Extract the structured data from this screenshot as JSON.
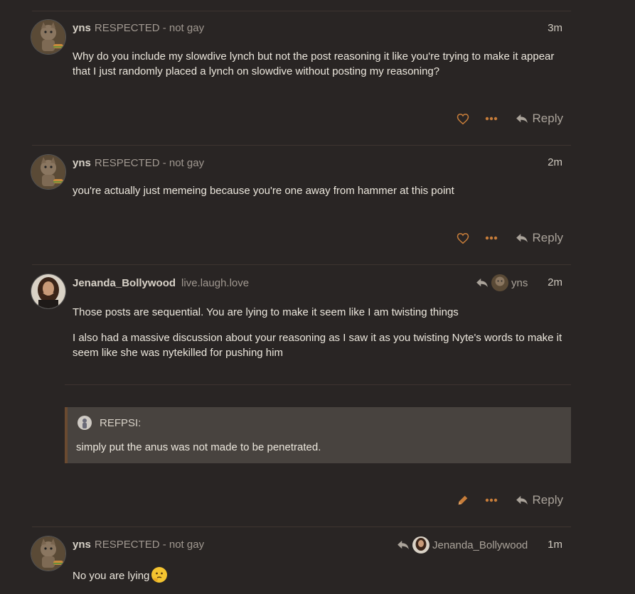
{
  "colors": {
    "background": "#292524",
    "accent": "#c77d3a",
    "muted": "#aaa39a",
    "quote_bg": "#48433f"
  },
  "posts": [
    {
      "username": "yns",
      "user_title": "RESPECTED - not gay",
      "age": "3m",
      "avatar_icon": "cat-avatar-icon",
      "paragraphs": [
        "Why do you include my slowdive lynch but not the post reasoning it like you're trying to make it appear that I just randomly placed a lynch on slowdive without posting my reasoning?"
      ],
      "actions": {
        "like_icon": "heart-icon",
        "more_icon": "ellipsis-icon",
        "reply_label": "Reply"
      }
    },
    {
      "username": "yns",
      "user_title": "RESPECTED - not gay",
      "age": "2m",
      "avatar_icon": "cat-avatar-icon",
      "paragraphs": [
        "you're actually just memeing because you're one away from hammer at this point"
      ],
      "actions": {
        "like_icon": "heart-icon",
        "more_icon": "ellipsis-icon",
        "reply_label": "Reply"
      }
    },
    {
      "username": "Jenanda_Bollywood",
      "user_title": "live.laugh.love",
      "age": "2m",
      "avatar_icon": "woman-avatar-icon",
      "reply_to": {
        "icon": "reply-arrow-icon",
        "username": "yns"
      },
      "paragraphs": [
        "Those posts are sequential. You are lying to make it seem like I am twisting things",
        "I also had a massive discussion about your reasoning as I saw it as you twisting Nyte's words to make it seem like she was nytekilled for pushing him"
      ],
      "quote": {
        "author": "REFPSI:",
        "text": "simply put the anus was not made to be penetrated."
      },
      "actions": {
        "edit_icon": "pencil-icon",
        "more_icon": "ellipsis-icon",
        "reply_label": "Reply"
      }
    },
    {
      "username": "yns",
      "user_title": "RESPECTED - not gay",
      "age": "1m",
      "avatar_icon": "cat-avatar-icon",
      "reply_to": {
        "icon": "reply-arrow-icon",
        "username": "Jenanda_Bollywood"
      },
      "paragraphs": [
        "No you are lying"
      ],
      "emoji": "thinking-face-emoji"
    }
  ]
}
